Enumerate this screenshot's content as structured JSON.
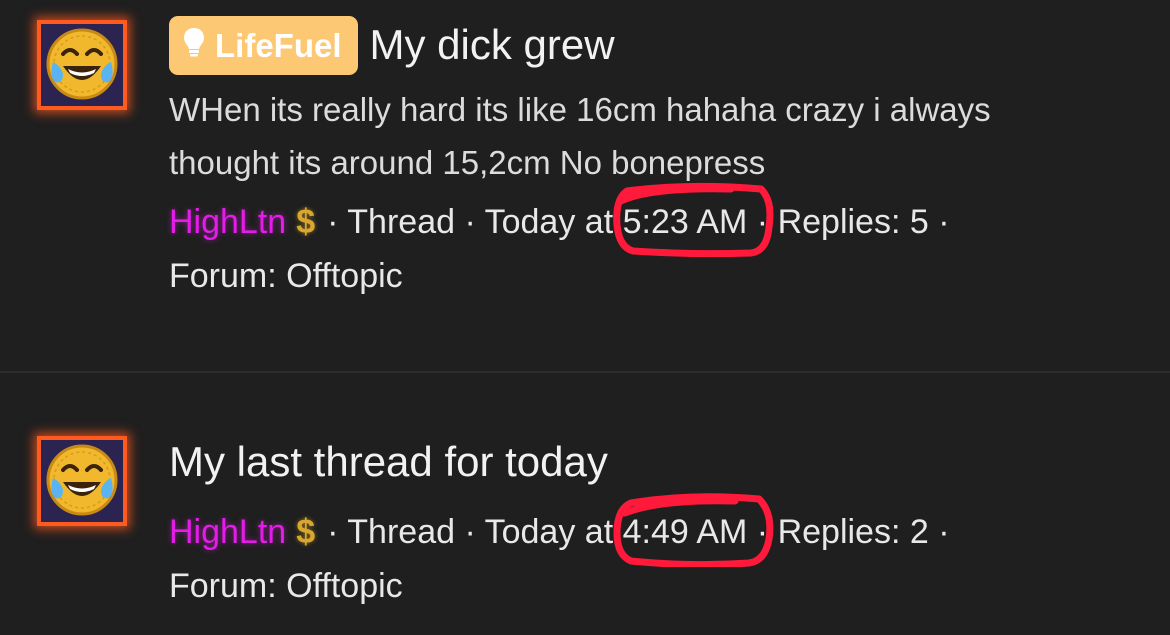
{
  "colors": {
    "background": "#1f1f1f",
    "username": "#e21de7",
    "prefix_badge": "#fcc873",
    "avatar_border": "#ff5a1f",
    "annotation_circle": "#ff1a3c",
    "dollar": "#d9a62e"
  },
  "threads": [
    {
      "avatar_icon": "laughing-crying-coin-emoji",
      "prefix": {
        "icon": "lightbulb-icon",
        "label": "LifeFuel"
      },
      "title": "My dick grew",
      "snippet": "WHen its really hard its like 16cm hahaha crazy i always thought its around 15,2cm No bonepress",
      "username": "HighLtn",
      "user_badge_icon": "dollar-sign-icon",
      "user_badge_text": "$",
      "type_text": "· Thread · Today at",
      "time": "5:23 AM",
      "replies_text": "· Replies: 5 ·",
      "forum_text": "Forum: Offtopic"
    },
    {
      "avatar_icon": "laughing-crying-coin-emoji",
      "title": "My last thread for today",
      "username": "HighLtn",
      "user_badge_icon": "dollar-sign-icon",
      "user_badge_text": "$",
      "type_text": "· Thread · Today at",
      "time": "4:49 AM",
      "replies_text": "· Replies: 2 ·",
      "forum_text": "Forum: Offtopic"
    }
  ]
}
